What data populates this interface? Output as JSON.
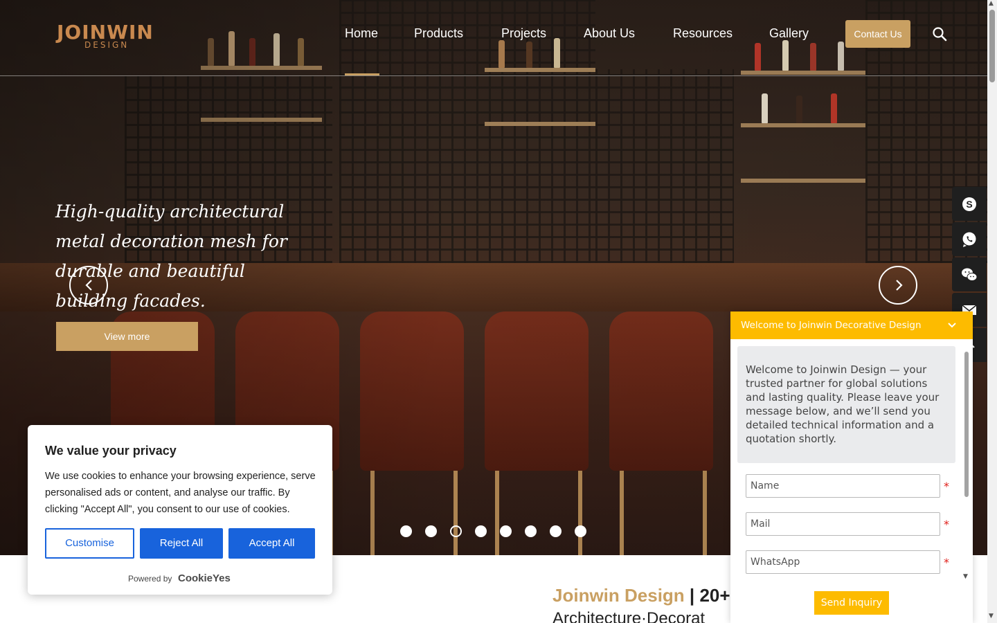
{
  "header": {
    "logo_main": "JOINWIN",
    "logo_sub": "DESIGN",
    "nav": [
      "Home",
      "Products",
      "Projects",
      "About Us",
      "Resources",
      "Gallery"
    ],
    "active_nav": "Home",
    "contact_label": "Contact Us",
    "icons": [
      "search-icon"
    ]
  },
  "hero": {
    "title": "High-quality architectural metal decoration mesh for durable and beautiful building facades.",
    "cta_label": "View more",
    "slide_count": 8,
    "active_slide": 3,
    "icons": [
      "chevron-left-icon",
      "chevron-right-icon"
    ]
  },
  "social_bar": {
    "icons": [
      "skype-icon",
      "whatsapp-icon",
      "wechat-icon",
      "mail-icon",
      "back-to-top-icon"
    ]
  },
  "cookie_banner": {
    "title": "We value your privacy",
    "text": "We use cookies to enhance your browsing experience, serve personalised ads or content, and analyse our traffic. By clicking \"Accept All\", you consent to our use of cookies.",
    "customise_label": "Customise",
    "reject_label": "Reject All",
    "accept_label": "Accept All",
    "powered_by": "Powered by",
    "provider": "CookieYes",
    "accent_color": "#1863dc"
  },
  "about": {
    "brand": "Joinwin Design",
    "separator": "|",
    "heading_rest": "20+",
    "subheading": "Architecture·Decorat"
  },
  "chat": {
    "title": "Welcome to Joinwin Decorative Design",
    "message": "Welcome to Joinwin Design — your trusted partner for global solutions and lasting quality. Please leave your message below, and we’ll send you detailed technical information and a quotation shortly.",
    "fields": [
      {
        "placeholder": "Name",
        "required_mark": "*"
      },
      {
        "placeholder": "Mail",
        "required_mark": "*"
      },
      {
        "placeholder": "WhatsApp",
        "required_mark": "*"
      }
    ],
    "send_label": "Send Inquiry",
    "accent_color": "#fdbb00"
  },
  "colors": {
    "gold": "#c9a062",
    "logo": "#c9894f"
  }
}
